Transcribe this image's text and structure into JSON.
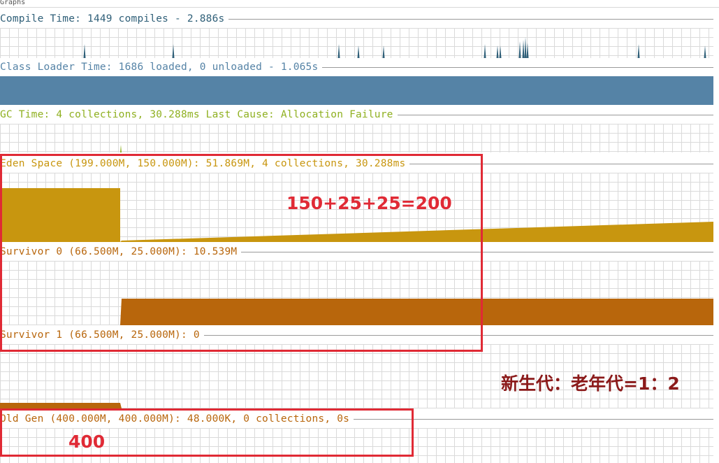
{
  "tab_label": "Graphs",
  "panels": {
    "compile": {
      "label": "Compile Time: 1449 compiles - 2.886s",
      "color": "#2f5f78"
    },
    "classloader": {
      "label": "Class Loader Time: 1686 loaded, 0 unloaded - 1.065s",
      "color": "#5583a6"
    },
    "gc": {
      "label": "GC Time: 4 collections, 30.288ms Last Cause: Allocation Failure",
      "color": "#8fb020"
    },
    "eden": {
      "label": "Eden Space (199.000M, 150.000M): 51.869M, 4 collections, 30.288ms",
      "color": "#c8960f"
    },
    "survivor0": {
      "label": "Survivor 0 (66.500M, 25.000M): 10.539M",
      "color": "#b8660c"
    },
    "survivor1": {
      "label": "Survivor 1 (66.500M, 25.000M): 0",
      "color": "#b8660c"
    },
    "oldgen": {
      "label": "Old Gen (400.000M, 400.000M): 48.000K, 0 collections, 0s",
      "color": "#b8660c"
    }
  },
  "annotations": {
    "young_sum": "150+25+25=200",
    "ratio": "新生代：老年代=1：2",
    "old_size": "400"
  },
  "colors": {
    "highlight_box": "#e02a35",
    "annotation_red": "#e02a35",
    "annotation_dark": "#8b1a1a"
  }
}
